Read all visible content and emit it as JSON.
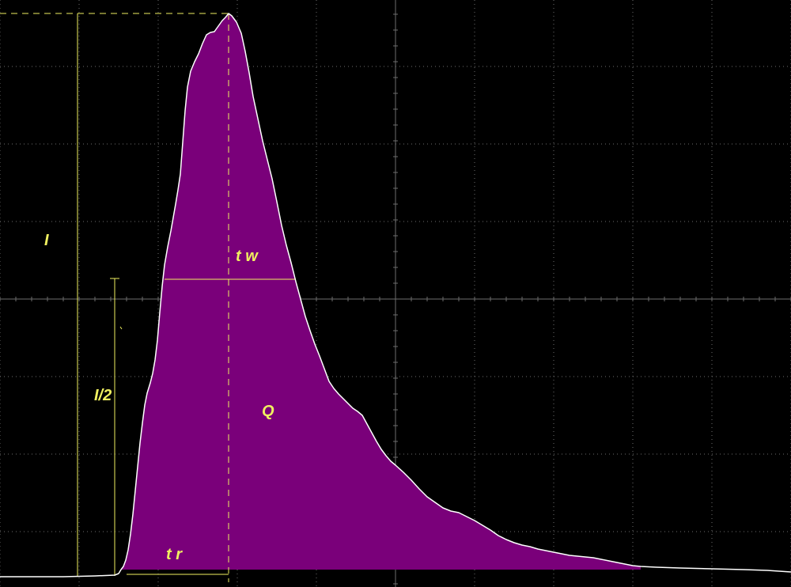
{
  "labels": {
    "peak_current": "I",
    "half_current": "I/2",
    "pulse_width": "t w",
    "charge": "Q",
    "rise_time": "t r"
  },
  "colors": {
    "background": "#000000",
    "fill": "#7a007a",
    "trace": "#ffffff",
    "annotation": "#f0f060",
    "grid": "#6e6e6e"
  }
}
